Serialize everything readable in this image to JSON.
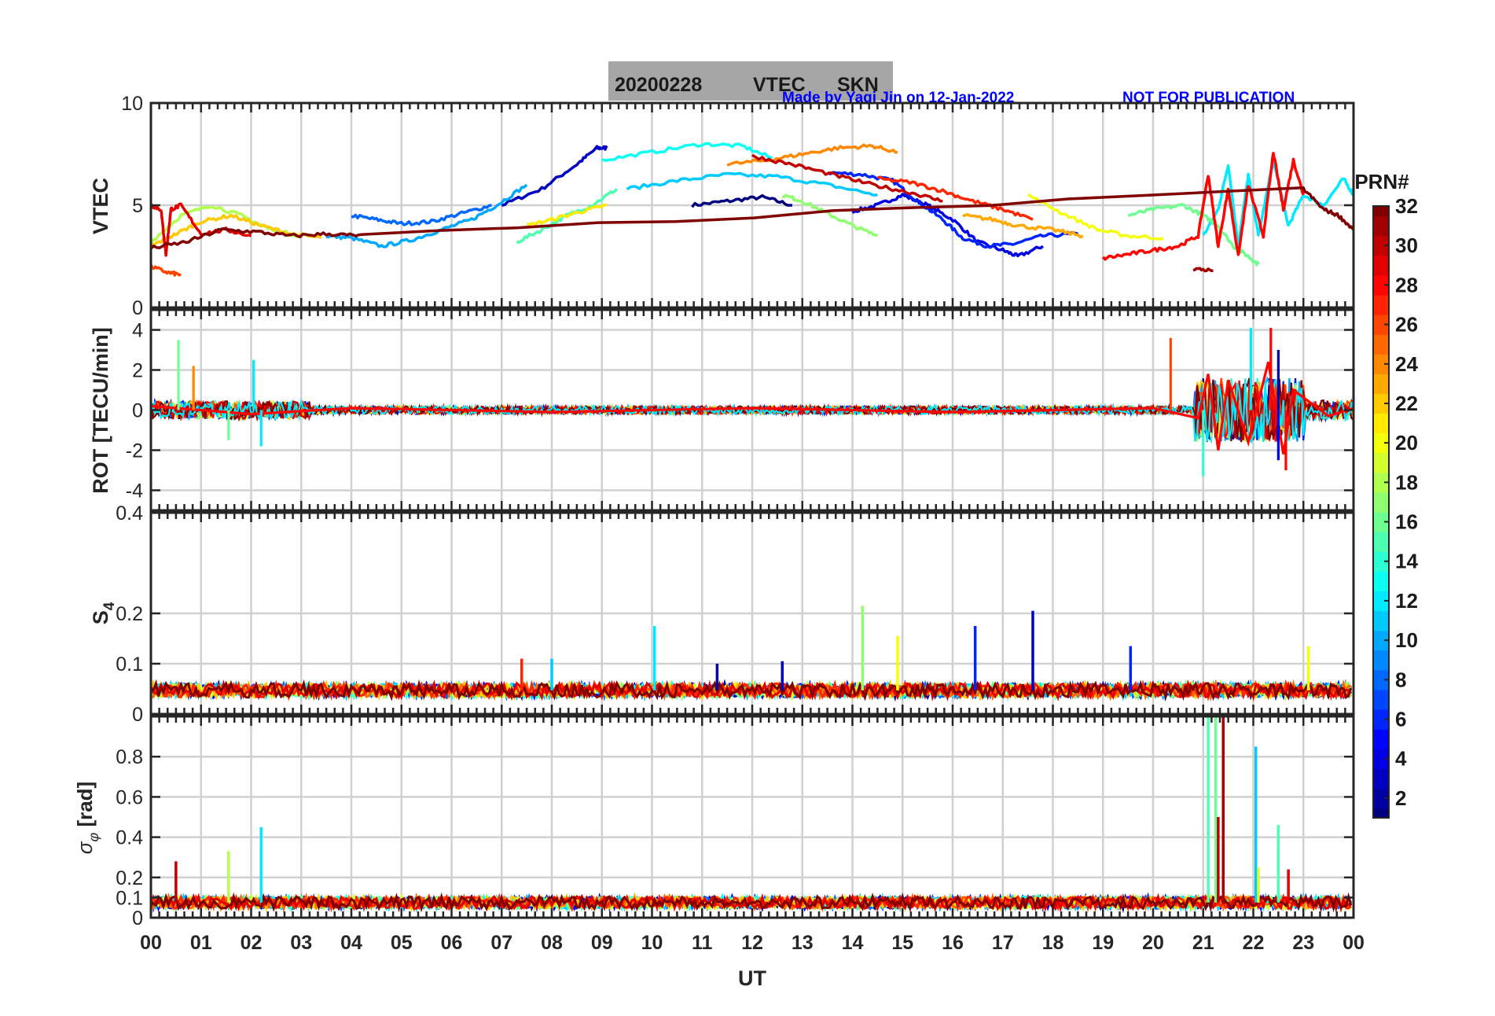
{
  "title_box": {
    "date": "20200228",
    "parameter": "VTEC",
    "station": "SKN"
  },
  "credit": "Made by Yaqi Jin on 12-Jan-2022",
  "notice": "NOT FOR PUBLICATION",
  "xlabel": "UT",
  "colorbar": {
    "label": "PRN#",
    "range": [
      1,
      32
    ],
    "ticks": [
      "2",
      "4",
      "6",
      "8",
      "10",
      "12",
      "14",
      "16",
      "18",
      "20",
      "22",
      "24",
      "26",
      "28",
      "30",
      "32"
    ],
    "colormap": "jet"
  },
  "chart_data": [
    {
      "type": "line",
      "ylabel": "VTEC",
      "ylim": [
        0,
        10
      ],
      "xlim": [
        0,
        24
      ],
      "x_tick_labels": [
        "00",
        "01",
        "02",
        "03",
        "04",
        "05",
        "06",
        "07",
        "08",
        "09",
        "10",
        "11",
        "12",
        "13",
        "14",
        "15",
        "16",
        "17",
        "18",
        "19",
        "20",
        "21",
        "22",
        "23",
        "00"
      ],
      "y_tick_labels": [
        "0",
        "5",
        "10"
      ],
      "grid": true,
      "series": [
        {
          "prn": 1,
          "x": [
            10.8,
            11.5,
            12.2,
            12.8
          ],
          "y": [
            5.0,
            5.2,
            5.4,
            5.0
          ]
        },
        {
          "prn": 3,
          "x": [
            7.0,
            7.8,
            8.5,
            8.9,
            9.1
          ],
          "y": [
            5.0,
            5.8,
            7.0,
            7.8,
            7.8
          ]
        },
        {
          "prn": 4,
          "x": [
            14.0,
            14.5,
            15.0,
            15.5,
            16.0,
            16.5,
            17.0,
            17.3,
            17.8
          ],
          "y": [
            4.7,
            5.0,
            5.5,
            5.0,
            4.3,
            3.2,
            2.8,
            2.5,
            3.0
          ]
        },
        {
          "prn": 6,
          "x": [
            13.5,
            14.2,
            14.8,
            15.3,
            15.8,
            16.2,
            16.7,
            17.2,
            17.8,
            18.5
          ],
          "y": [
            6.6,
            6.5,
            6.2,
            5.2,
            4.3,
            3.4,
            3.0,
            3.1,
            3.5,
            3.6
          ]
        },
        {
          "prn": 8,
          "x": [
            4.0,
            4.5,
            5.0,
            5.6,
            6.2,
            6.8
          ],
          "y": [
            4.5,
            4.3,
            4.1,
            4.2,
            4.6,
            5.0
          ]
        },
        {
          "prn": 10,
          "x": [
            3.5,
            4.0,
            4.6,
            5.2,
            5.8,
            6.4,
            6.9,
            7.5
          ],
          "y": [
            3.5,
            3.4,
            3.0,
            3.3,
            3.8,
            4.3,
            5.0,
            6.0
          ]
        },
        {
          "prn": 11,
          "x": [
            9.5,
            10.5,
            11.5,
            12.5,
            13.5,
            14.5
          ],
          "y": [
            5.8,
            6.2,
            6.5,
            6.4,
            6.0,
            5.5
          ]
        },
        {
          "prn": 12,
          "x": [
            21.0,
            21.3,
            21.5,
            21.7,
            21.9,
            22.1,
            22.4,
            22.7,
            23.0,
            23.4,
            23.8,
            24.0
          ],
          "y": [
            3.5,
            4.8,
            7.0,
            3.0,
            6.5,
            3.5,
            7.2,
            4.0,
            5.5,
            5.0,
            6.3,
            5.5
          ]
        },
        {
          "prn": 13,
          "x": [
            9.0,
            10.0,
            11.0,
            11.8,
            12.4
          ],
          "y": [
            7.2,
            7.6,
            8.0,
            7.9,
            7.3
          ]
        },
        {
          "prn": 15,
          "x": [
            7.3,
            7.8,
            8.3,
            8.8,
            9.3
          ],
          "y": [
            3.2,
            3.8,
            4.5,
            5.0,
            5.8
          ]
        },
        {
          "prn": 16,
          "x": [
            19.5,
            20.0,
            20.6,
            21.0,
            21.3,
            21.6,
            21.9,
            22.1
          ],
          "y": [
            4.5,
            4.8,
            5.0,
            4.5,
            4.0,
            3.0,
            2.5,
            2.1
          ]
        },
        {
          "prn": 17,
          "x": [
            12.6,
            13.0,
            13.5,
            14.0,
            14.5
          ],
          "y": [
            5.5,
            5.2,
            4.6,
            4.0,
            3.5
          ]
        },
        {
          "prn": 18,
          "x": [
            0.0,
            0.6,
            1.2,
            1.8,
            2.4,
            3.0
          ],
          "y": [
            3.2,
            4.5,
            5.0,
            4.5,
            3.8,
            3.5
          ]
        },
        {
          "prn": 20,
          "x": [
            17.5,
            18.2,
            18.9,
            19.5,
            20.2
          ],
          "y": [
            5.5,
            4.6,
            3.8,
            3.5,
            3.4
          ]
        },
        {
          "prn": 21,
          "x": [
            7.5,
            8.0,
            8.6,
            9.1
          ],
          "y": [
            4.0,
            4.3,
            4.7,
            5.0
          ]
        },
        {
          "prn": 22,
          "x": [
            0.0,
            0.5,
            1.0,
            1.6,
            2.2,
            2.8,
            3.4
          ],
          "y": [
            3.0,
            3.6,
            4.2,
            4.5,
            4.0,
            3.6,
            3.4
          ]
        },
        {
          "prn": 23,
          "x": [
            16.2,
            16.8,
            17.3,
            18.0,
            18.6
          ],
          "y": [
            4.5,
            4.3,
            4.0,
            3.8,
            3.5
          ]
        },
        {
          "prn": 24,
          "x": [
            11.5,
            12.3,
            13.0,
            13.7,
            14.4,
            14.9
          ],
          "y": [
            7.0,
            7.2,
            7.5,
            7.8,
            7.9,
            7.6
          ]
        },
        {
          "prn": 26,
          "x": [
            0.0,
            0.35,
            0.6
          ],
          "y": [
            2.0,
            1.7,
            1.6
          ]
        },
        {
          "prn": 27,
          "x": [
            14.5,
            15.2,
            15.8,
            16.4,
            17.0,
            17.6
          ],
          "y": [
            6.3,
            6.1,
            5.7,
            5.2,
            4.8,
            4.3
          ]
        },
        {
          "prn": 28,
          "x": [
            19.0,
            19.5,
            20.0,
            20.5,
            20.9,
            21.1,
            21.3,
            21.5,
            21.7,
            21.9,
            22.2,
            22.4,
            22.6,
            22.8,
            23.0
          ],
          "y": [
            2.4,
            2.6,
            2.8,
            3.0,
            3.5,
            6.5,
            3.0,
            5.8,
            2.5,
            6.0,
            3.5,
            7.6,
            4.8,
            7.2,
            5.5
          ]
        },
        {
          "prn": 29,
          "x": [
            0.0,
            0.2,
            0.3,
            0.4,
            0.6,
            1.0,
            1.5,
            2.0
          ],
          "y": [
            5.0,
            4.8,
            2.6,
            4.8,
            5.0,
            3.6,
            3.8,
            3.5
          ]
        },
        {
          "prn": 30,
          "x": [
            12.0,
            12.8,
            13.6,
            14.4,
            15.2,
            15.8
          ],
          "y": [
            7.4,
            7.0,
            6.5,
            6.0,
            5.6,
            5.2
          ]
        },
        {
          "prn": 31,
          "x": [
            20.8,
            21.2
          ],
          "y": [
            1.9,
            1.8
          ]
        },
        {
          "prn": 32,
          "x": [
            0.0,
            0.7,
            1.4,
            2.1,
            2.8,
            3.5,
            4.2,
            23.0,
            23.4,
            23.7,
            24.0
          ],
          "y": [
            2.9,
            3.2,
            3.8,
            3.7,
            3.5,
            3.6,
            3.5,
            5.8,
            4.8,
            4.5,
            3.8
          ]
        }
      ]
    },
    {
      "type": "line",
      "ylabel": "ROT [TECU/min]",
      "ylim": [
        -5,
        5
      ],
      "xlim": [
        0,
        24
      ],
      "y_tick_labels": [
        "-4",
        "-2",
        "0",
        "2",
        "4"
      ],
      "grid": true,
      "series": [
        {
          "prn": 28,
          "name": "",
          "x": [
            0.0,
            2.0,
            4.0,
            8.0,
            12.0,
            16.0,
            20.0,
            20.9,
            21.1,
            21.3,
            21.5,
            21.9,
            22.3,
            22.6,
            22.8,
            23.5,
            24.0
          ],
          "y": [
            0.2,
            -0.2,
            0.1,
            -0.1,
            0.1,
            -0.1,
            0.1,
            -0.4,
            1.8,
            -2.0,
            1.5,
            -1.6,
            2.4,
            -2.2,
            1.0,
            -0.3,
            0.1
          ]
        }
      ],
      "spikes": [
        {
          "x": 0.55,
          "y": 3.5,
          "prn": 16
        },
        {
          "x": 0.85,
          "y": 2.2,
          "prn": 24
        },
        {
          "x": 2.05,
          "y": 2.5,
          "prn": 12
        },
        {
          "x": 1.55,
          "y": -1.5,
          "prn": 16
        },
        {
          "x": 2.2,
          "y": -1.8,
          "prn": 12
        },
        {
          "x": 20.35,
          "y": 3.6,
          "prn": 26
        },
        {
          "x": 21.0,
          "y": -3.3,
          "prn": 14
        },
        {
          "x": 21.95,
          "y": 4.1,
          "prn": 12
        },
        {
          "x": 22.35,
          "y": 4.1,
          "prn": 28
        },
        {
          "x": 22.5,
          "y": 3.0,
          "prn": 2
        },
        {
          "x": 22.65,
          "y": -3.0,
          "prn": 28
        },
        {
          "x": 22.5,
          "y": -2.5,
          "prn": 4
        }
      ]
    },
    {
      "type": "line",
      "ylabel": "S4",
      "ylim": [
        0,
        0.4
      ],
      "xlim": [
        0,
        24
      ],
      "y_tick_labels": [
        "0",
        "0.1",
        "0.2",
        "0.4"
      ],
      "grid": true,
      "baseline": {
        "x": [
          0,
          3,
          6,
          9,
          12,
          15,
          18,
          21,
          24
        ],
        "y": [
          0.05,
          0.045,
          0.05,
          0.045,
          0.05,
          0.045,
          0.05,
          0.045,
          0.05
        ]
      },
      "spikes": [
        {
          "x": 10.05,
          "y": 0.175,
          "prn": 12
        },
        {
          "x": 14.2,
          "y": 0.215,
          "prn": 17
        },
        {
          "x": 14.9,
          "y": 0.155,
          "prn": 20
        },
        {
          "x": 16.45,
          "y": 0.175,
          "prn": 6
        },
        {
          "x": 17.6,
          "y": 0.205,
          "prn": 3
        },
        {
          "x": 19.55,
          "y": 0.135,
          "prn": 6
        },
        {
          "x": 23.1,
          "y": 0.135,
          "prn": 20
        },
        {
          "x": 8.0,
          "y": 0.11,
          "prn": 11
        },
        {
          "x": 7.4,
          "y": 0.11,
          "prn": 27
        },
        {
          "x": 11.3,
          "y": 0.1,
          "prn": 2
        },
        {
          "x": 12.6,
          "y": 0.105,
          "prn": 3
        }
      ]
    },
    {
      "type": "line",
      "ylabel": "σφ [rad]",
      "ylim": [
        0,
        1
      ],
      "xlim": [
        0,
        24
      ],
      "y_tick_labels": [
        "0",
        "0.1",
        "0.2",
        "0.4",
        "0.6",
        "0.8"
      ],
      "grid": true,
      "baseline": {
        "x": [
          0,
          3,
          6,
          9,
          12,
          15,
          18,
          21,
          24
        ],
        "y": [
          0.08,
          0.07,
          0.08,
          0.07,
          0.08,
          0.07,
          0.08,
          0.07,
          0.08
        ]
      },
      "spikes": [
        {
          "x": 0.5,
          "y": 0.28,
          "prn": 30
        },
        {
          "x": 1.55,
          "y": 0.33,
          "prn": 18
        },
        {
          "x": 2.2,
          "y": 0.45,
          "prn": 12
        },
        {
          "x": 21.1,
          "y": 1.0,
          "prn": 15
        },
        {
          "x": 21.25,
          "y": 1.0,
          "prn": 16
        },
        {
          "x": 21.3,
          "y": 0.5,
          "prn": 30
        },
        {
          "x": 21.4,
          "y": 1.0,
          "prn": 31
        },
        {
          "x": 22.05,
          "y": 0.85,
          "prn": 11
        },
        {
          "x": 22.5,
          "y": 0.46,
          "prn": 15
        },
        {
          "x": 22.1,
          "y": 0.25,
          "prn": 19
        },
        {
          "x": 22.7,
          "y": 0.24,
          "prn": 29
        }
      ]
    }
  ]
}
